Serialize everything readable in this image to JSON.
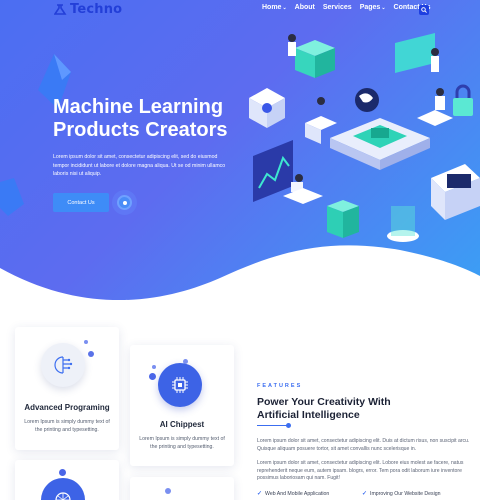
{
  "brand": {
    "name": "Techno",
    "logo_icon": "flask-logo-icon",
    "color": "#233fd8"
  },
  "nav": {
    "items": [
      {
        "label": "Home",
        "dropdown": true
      },
      {
        "label": "About",
        "dropdown": false
      },
      {
        "label": "Services",
        "dropdown": false
      },
      {
        "label": "Pages",
        "dropdown": true
      },
      {
        "label": "Contact Us",
        "dropdown": false
      }
    ],
    "search_icon": "search-icon"
  },
  "hero": {
    "title_line1": "Machine Learning",
    "title_line2": "Products Creators",
    "description": "Lorem ipsum dolor sit amet, consectetur adipiscing elit, sed do eiusmod tempor incididunt ut labore et dolore magna aliqua. Ut se od minim ullamco laboris nisi ut aliquip.",
    "cta_label": "Contact Us",
    "play_icon": "play-icon",
    "gradient_start": "#4b6ef2",
    "gradient_end": "#3aa0f5"
  },
  "cards": [
    {
      "title": "Advanced Programing",
      "text": "Lorem Ipsum is simply dummy text of the printing and typesetting.",
      "icon": "brain-circuit-icon"
    },
    {
      "title": "AI Chippest",
      "text": "Lorem Ipsum is simply dummy text of the printing and typesetting.",
      "icon": "chip-icon"
    },
    {
      "title": "",
      "text": "",
      "icon": "globe-network-icon"
    }
  ],
  "features": {
    "label": "FEATURES",
    "title_line1": "Power Your Creativity With",
    "title_line2": "Artificial Intelligence",
    "paragraph1": "Lorem ipsum dolor sit amet, consectetur adipiscing elit. Duis at dictum risus, non suscipit arcu. Quisque aliquam posuere tortor, sit amet convallis nunc scelerisque in.",
    "paragraph2": "Lorem ipsum dolor sit amet, consectetur adipiscing elit. Lobore eius molest ae facere, natus reprehenderit neque eum, autem ipsam. blogrs, error. Tem pora odit laborum iure inventore possimus laboriosam qui nam. Fugit!",
    "checklist": [
      "Web And Mobile Application",
      "Improving Our Website Design"
    ],
    "accent": "#3c6ef0"
  }
}
